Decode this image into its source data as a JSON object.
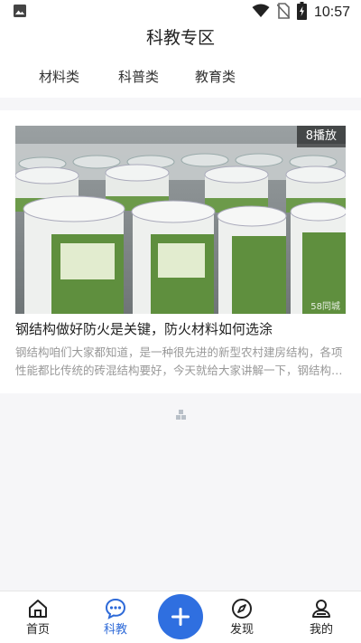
{
  "status_bar": {
    "time": "10:57",
    "icons": [
      "image-icon",
      "wifi-icon",
      "no-sim-icon",
      "battery-charging-icon"
    ]
  },
  "header": {
    "title": "科教专区",
    "tabs": [
      {
        "label": "材料类"
      },
      {
        "label": "科普类"
      },
      {
        "label": "教育类"
      }
    ]
  },
  "feed": {
    "items": [
      {
        "play_count": "8播放",
        "watermark": "58同城",
        "title": "钢结构做好防火是关键，防火材料如何选涂",
        "description": "钢结构咱们大家都知道，是一种很先进的新型农村建房结构，各项性能都比传统的砖混结构要好，今天就给大家讲解一下，钢结构做好防火是关键，防火材料如何选涂"
      }
    ]
  },
  "bottom_nav": {
    "items": [
      {
        "label": "首页",
        "icon": "home-icon"
      },
      {
        "label": "科教",
        "icon": "chat-icon"
      },
      {
        "label": "发现",
        "icon": "compass-icon"
      },
      {
        "label": "我的",
        "icon": "user-icon"
      }
    ],
    "fab_icon": "plus-icon",
    "active_color": "#2e6ad8",
    "fab_color": "#2f6fe0"
  }
}
